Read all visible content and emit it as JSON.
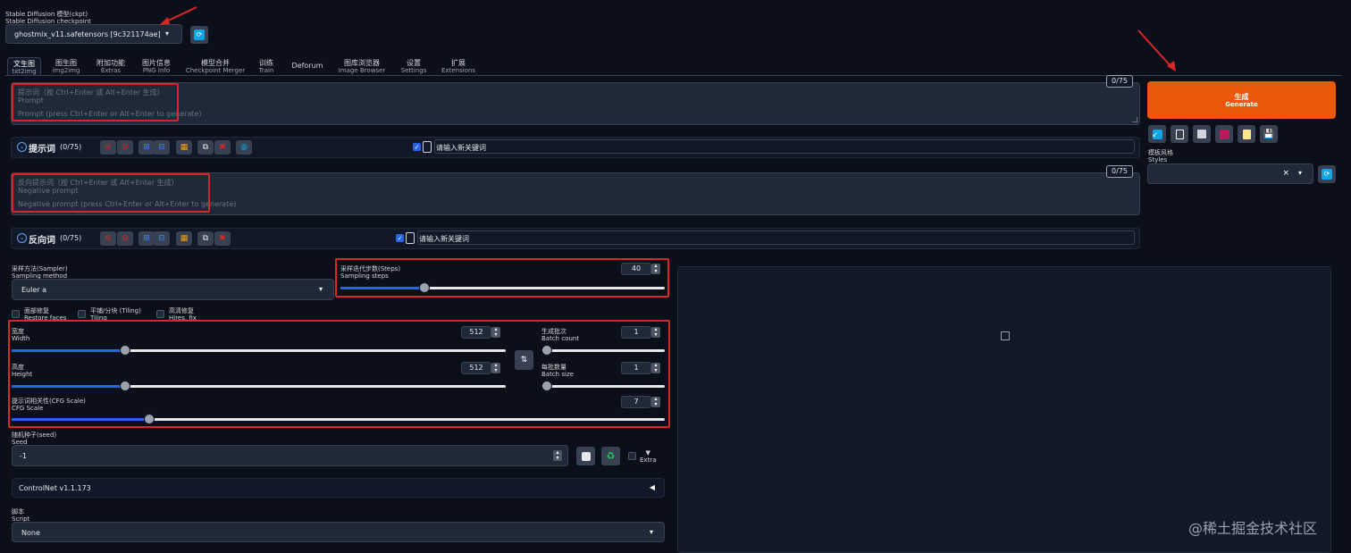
{
  "checkpoint": {
    "label_zh": "Stable Diffusion 模型(ckpt)",
    "label_en": "Stable Diffusion checkpoint",
    "value": "ghostmix_v11.safetensors [9c321174ae]"
  },
  "tabs": [
    {
      "zh": "文生图",
      "en": "txt2img"
    },
    {
      "zh": "图生图",
      "en": "img2img"
    },
    {
      "zh": "附加功能",
      "en": "Extras"
    },
    {
      "zh": "图片信息",
      "en": "PNG Info"
    },
    {
      "zh": "模型合并",
      "en": "Checkpoint Merger"
    },
    {
      "zh": "训练",
      "en": "Train"
    },
    {
      "zh": "Deforum",
      "en": ""
    },
    {
      "zh": "图库浏览器",
      "en": "Image Browser"
    },
    {
      "zh": "设置",
      "en": "Settings"
    },
    {
      "zh": "扩展",
      "en": "Extensions"
    }
  ],
  "prompt": {
    "placeholder_zh": "提示词（按 Ctrl+Enter 或 Alt+Enter 生成）",
    "placeholder_label": "Prompt",
    "placeholder_en": "Prompt (press Ctrl+Enter or Alt+Enter to generate)",
    "counter": "0/75",
    "tag_title": "提示词",
    "tag_count": "(0/75)",
    "keyword_placeholder": "请输入新关键词"
  },
  "negative": {
    "placeholder_zh": "反向提示词（按 Ctrl+Enter 或 Alt+Enter 生成）",
    "placeholder_label": "Negative prompt",
    "placeholder_en": "Negative prompt (press Ctrl+Enter or Alt+Enter to generate)",
    "counter": "0/75",
    "tag_title": "反向词",
    "tag_count": "(0/75)",
    "keyword_placeholder": "请输入新关键词"
  },
  "generate": {
    "zh": "生成",
    "en": "Generate"
  },
  "styles": {
    "zh": "模板风格",
    "en": "Styles",
    "clear": "×",
    "caret": "▾"
  },
  "sampler": {
    "zh": "采样方法(Sampler)",
    "en": "Sampling method",
    "value": "Euler a"
  },
  "steps": {
    "zh": "采样迭代步数(Steps)",
    "en": "Sampling steps",
    "value": "40",
    "fraction": 0.26
  },
  "checkboxes": [
    {
      "zh": "面部修复",
      "en": "Restore faces"
    },
    {
      "zh": "平铺/分块 (Tiling)",
      "en": "Tiling"
    },
    {
      "zh": "高清修复",
      "en": "Hires. fix"
    }
  ],
  "width": {
    "zh": "宽度",
    "en": "Width",
    "value": "512",
    "fraction": 0.23
  },
  "height": {
    "zh": "高度",
    "en": "Height",
    "value": "512",
    "fraction": 0.23
  },
  "batch_count": {
    "zh": "生成批次",
    "en": "Batch count",
    "value": "1",
    "fraction": 0.0
  },
  "batch_size": {
    "zh": "每批数量",
    "en": "Batch size",
    "value": "1",
    "fraction": 0.0
  },
  "cfg": {
    "zh": "提示词相关性(CFG Scale)",
    "en": "CFG Scale",
    "value": "7",
    "fraction": 0.21
  },
  "seed": {
    "zh": "随机种子(seed)",
    "en": "Seed",
    "value": "-1",
    "extra": "Extra",
    "extra_arrow": "▼"
  },
  "controlnet": {
    "label": "ControlNet v1.1.173",
    "arrow": "◀"
  },
  "script": {
    "zh": "脚本",
    "en": "Script",
    "value": "None"
  },
  "watermark": "@稀土掘金技术社区",
  "colors": {
    "accent": "#2563eb",
    "generate": "#ea580c",
    "annotation": "#dc2626"
  }
}
